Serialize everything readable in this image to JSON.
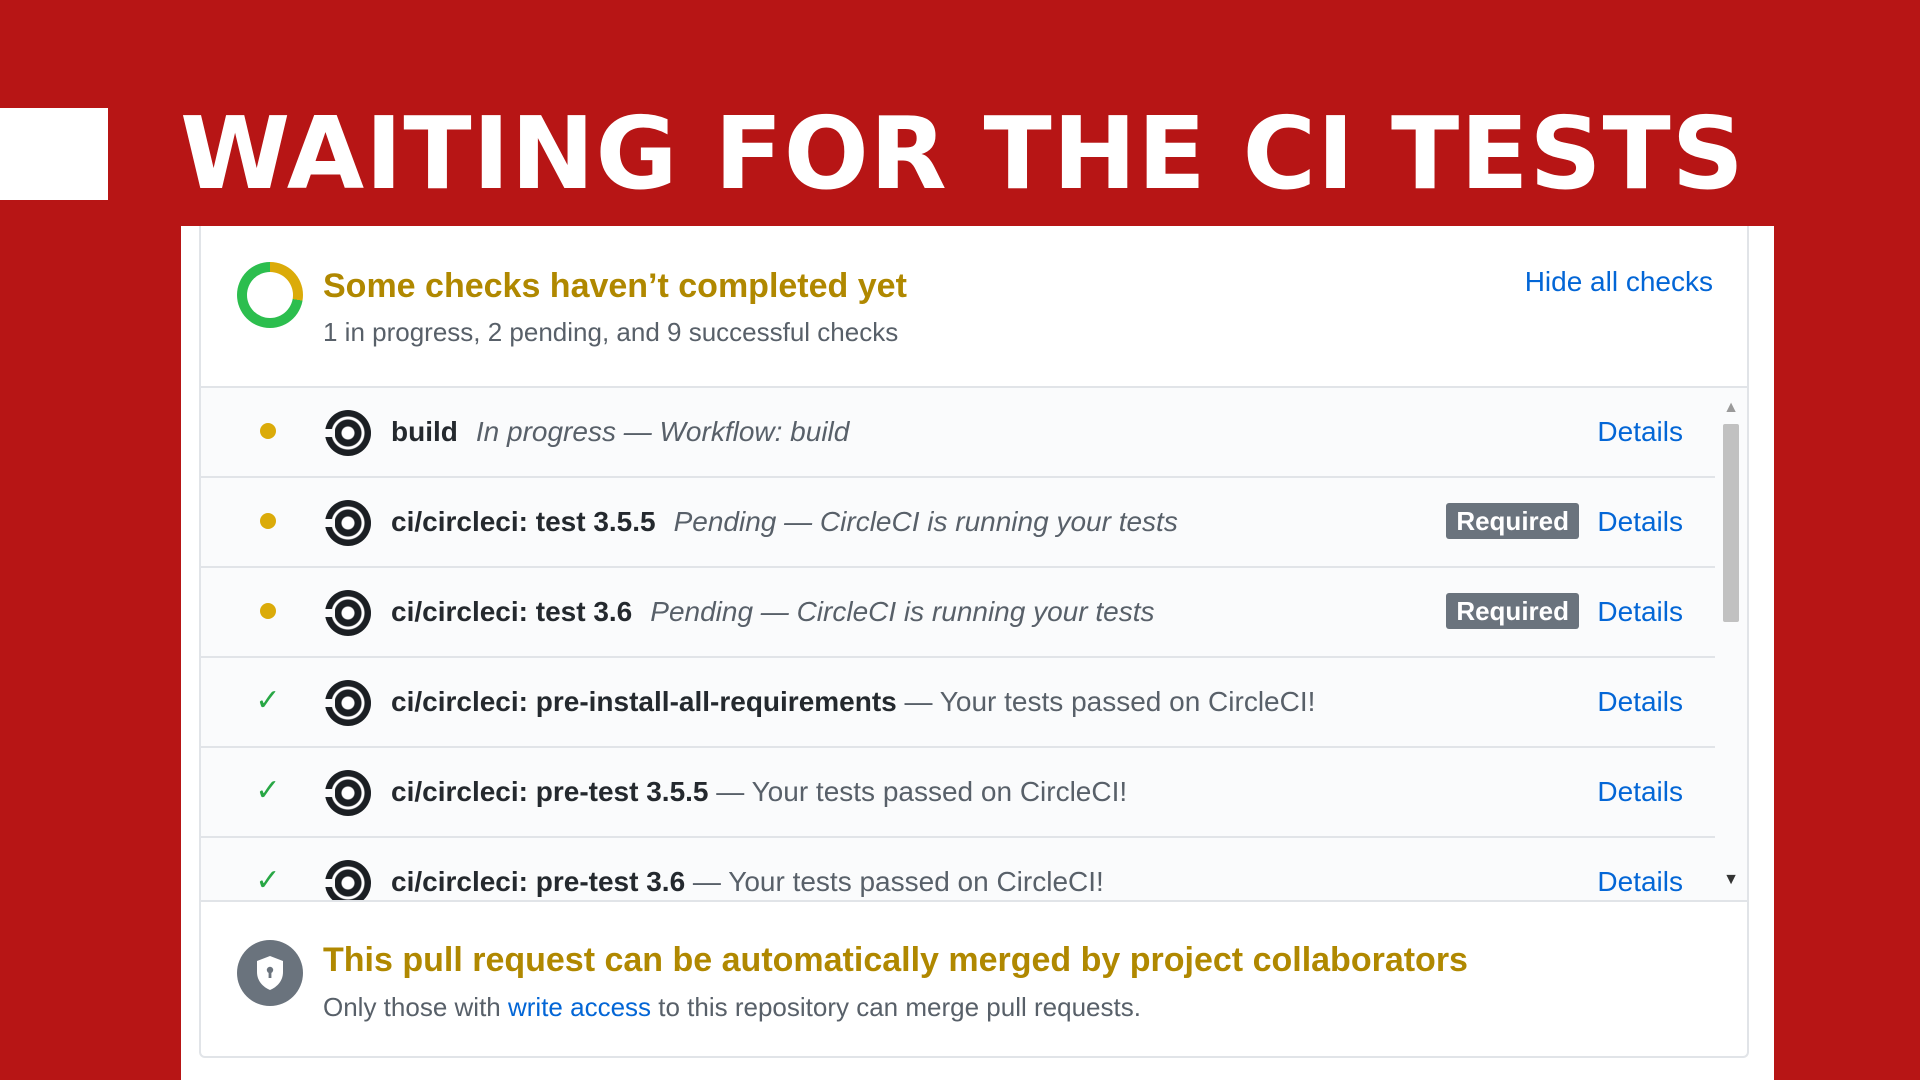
{
  "slide": {
    "title": "WAITING FOR THE CI TESTS"
  },
  "status": {
    "title": "Some checks haven’t completed yet",
    "summary": "1 in progress, 2 pending, and 9 successful checks",
    "hide_link": "Hide all checks"
  },
  "checks": [
    {
      "state": "pending",
      "name": "build",
      "description": "In progress — Workflow: build",
      "required": "",
      "details": "Details"
    },
    {
      "state": "pending",
      "name": "ci/circleci: test 3.5.5",
      "description": "Pending — CircleCI is running your tests",
      "required": "Required",
      "details": "Details"
    },
    {
      "state": "pending",
      "name": "ci/circleci: test 3.6",
      "description": "Pending — CircleCI is running your tests",
      "required": "Required",
      "details": "Details"
    },
    {
      "state": "success",
      "name": "ci/circleci: pre-install-all-requirements",
      "description": " — Your tests passed on CircleCI!",
      "required": "",
      "details": "Details"
    },
    {
      "state": "success",
      "name": "ci/circleci: pre-test 3.5.5",
      "description": " — Your tests passed on CircleCI!",
      "required": "",
      "details": "Details"
    },
    {
      "state": "success",
      "name": "ci/circleci: pre-test 3.6",
      "description": " — Your tests passed on CircleCI!",
      "required": "",
      "details": "Details"
    }
  ],
  "merge": {
    "title": "This pull request can be automatically merged by project collaborators",
    "desc_before": "Only those with ",
    "desc_link": "write access",
    "desc_after": " to this repository can merge pull requests."
  },
  "icons": {
    "status_ring": "progress-ring-icon",
    "pending": "pending-dot-icon",
    "success": "check-icon",
    "ci_logo": "circleci-logo-icon",
    "merge": "shield-lock-icon"
  },
  "colors": {
    "background": "#b71515",
    "pending": "#dbab09",
    "success": "#28a745",
    "link": "#0366d6",
    "warning_title": "#b08800",
    "badge": "#6a737d"
  }
}
